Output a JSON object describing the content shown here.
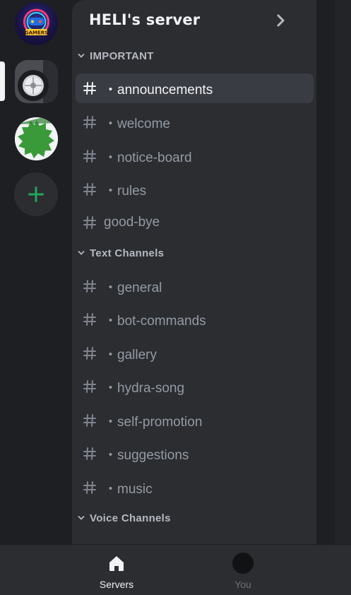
{
  "server": {
    "name": "HELI's server"
  },
  "rail": {
    "servers": [
      {
        "name": "GAMERS",
        "icon": "gamers-logo"
      },
      {
        "name": "",
        "icon": "wheel-image"
      },
      {
        "name": "",
        "icon": "green-badge"
      }
    ],
    "add_icon": "plus-icon",
    "accent": "#23a55a"
  },
  "categories": [
    {
      "label": "IMPORTANT",
      "channels": [
        {
          "label": "・announcements",
          "selected": true
        },
        {
          "label": "・welcome"
        },
        {
          "label": "・notice-board"
        },
        {
          "label": "・rules"
        },
        {
          "label": "good-bye"
        }
      ]
    },
    {
      "label": "Text Channels",
      "channels": [
        {
          "label": "・general"
        },
        {
          "label": "・bot-commands"
        },
        {
          "label": "・gallery"
        },
        {
          "label": "・hydra-song"
        },
        {
          "label": "・self-promotion"
        },
        {
          "label": "・suggestions"
        },
        {
          "label": "・music"
        }
      ]
    },
    {
      "label": "Voice Channels",
      "channels": []
    }
  ],
  "nav": {
    "servers_label": "Servers",
    "you_label": "You"
  }
}
